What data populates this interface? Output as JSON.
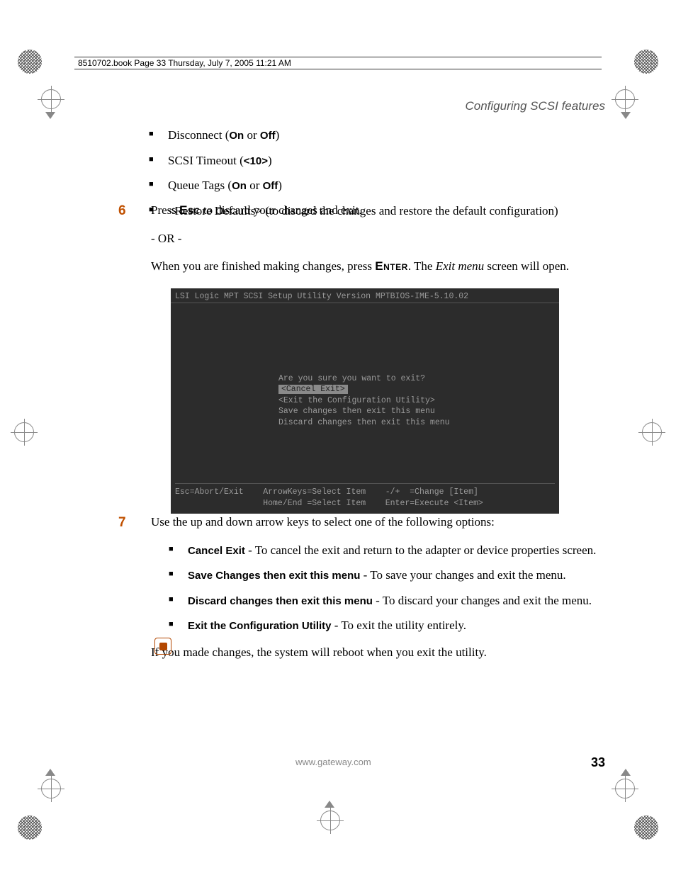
{
  "header": {
    "line_text": "8510702.book  Page 33  Thursday, July 7, 2005  11:21 AM"
  },
  "section_title": "Configuring SCSI features",
  "bullets_a": [
    {
      "prefix": "Disconnect (",
      "bold": "On",
      "mid": " or ",
      "bold2": "Off",
      "suffix": ")"
    },
    {
      "prefix": "SCSI Timeout (",
      "bold": "<10>",
      "mid": "",
      "bold2": "",
      "suffix": ")"
    },
    {
      "prefix": "Queue Tags (",
      "bold": "On",
      "mid": " or ",
      "bold2": "Off",
      "suffix": ")"
    },
    {
      "prefix": "<Restore Defaults> (to discard the changes and restore the default configuration)",
      "bold": "",
      "mid": "",
      "bold2": "",
      "suffix": ""
    }
  ],
  "step6": {
    "num": "6",
    "line1_a": "Press ",
    "line1_key": "Esc",
    "line1_b": " to discard your changes and exit.",
    "or": "- OR -",
    "line2_a": "When you are finished making changes, press ",
    "line2_key": "Enter",
    "line2_b": ". The ",
    "line2_italic": "Exit menu",
    "line2_c": " screen will open."
  },
  "bios": {
    "title": "LSI Logic MPT SCSI Setup Utility   Version  MPTBIOS-IME-5.10.02",
    "prompt": "Are you sure you want to exit?",
    "opt_cancel": " <Cancel Exit> ",
    "opt_exit": "<Exit the Configuration Utility>",
    "opt_save": "Save changes then exit this menu",
    "opt_discard": "Discard changes then exit this menu",
    "foot1": "Esc=Abort/Exit    ArrowKeys=Select Item    -/+  =Change [Item]",
    "foot2": "                  Home/End =Select Item    Enter=Execute <Item>"
  },
  "step7": {
    "num": "7",
    "intro": "Use the up and down arrow keys to select one of the following options:"
  },
  "bullets_b": [
    {
      "bold": "Cancel Exit",
      "text": " - To cancel the exit and return to the adapter or device properties screen."
    },
    {
      "bold": "Save Changes then exit this menu",
      "text": " - To save your changes and exit the menu."
    },
    {
      "bold": "Discard changes then exit this menu",
      "text": " - To discard your changes and exit the menu."
    },
    {
      "bold": "Exit the Configuration Utility",
      "text": " - To exit the utility entirely."
    }
  ],
  "closing": "If you made changes, the system will reboot when you exit the utility.",
  "footer": {
    "url": "www.gateway.com",
    "page": "33"
  }
}
